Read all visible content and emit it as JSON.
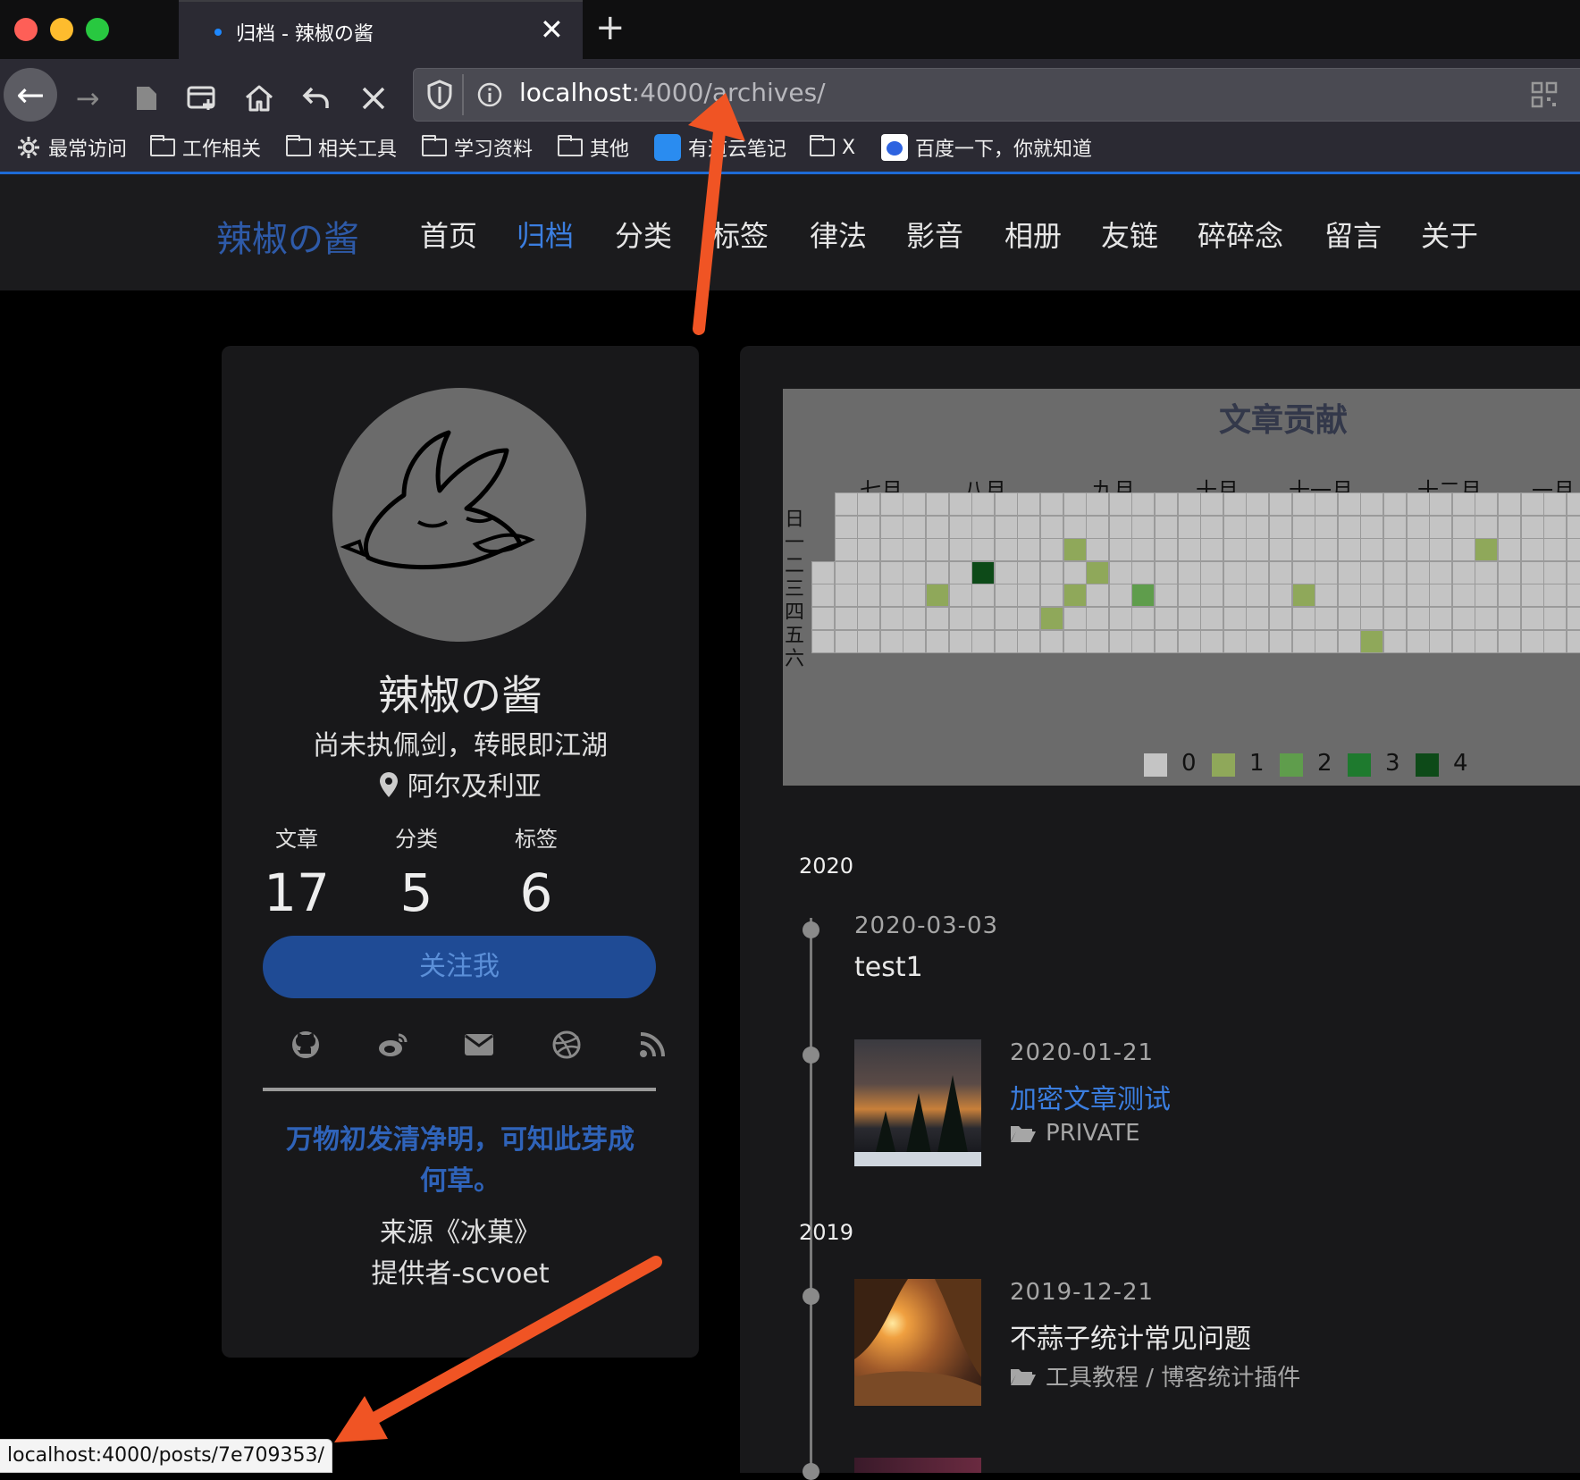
{
  "browser": {
    "tab_title": "归档 - 辣椒の酱",
    "tab_close": "✕",
    "new_tab": "+",
    "url_host": "localhost",
    "url_path": ":4000/archives/",
    "status_url": "localhost:4000/posts/7e709353/",
    "bookmarks": [
      "最常访问",
      "工作相关",
      "相关工具",
      "学习资料",
      "其他",
      "有道云笔记",
      "X",
      "百度一下，你就知道"
    ]
  },
  "site": {
    "logo": "辣椒の酱",
    "menu": [
      "首页",
      "归档",
      "分类",
      "标签",
      "律法",
      "影音",
      "相册",
      "友链",
      "碎碎念",
      "留言",
      "关于"
    ],
    "active_menu": "归档"
  },
  "profile": {
    "name": "辣椒の酱",
    "motto": "尚未执佩剑，转眼即江湖",
    "location": "阿尔及利亚",
    "stats": [
      {
        "label": "文章",
        "value": "17"
      },
      {
        "label": "分类",
        "value": "5"
      },
      {
        "label": "标签",
        "value": "6"
      }
    ],
    "follow_button": "关注我",
    "social_icons": [
      "github-icon",
      "weibo-icon",
      "email-icon",
      "dribbble-icon",
      "rss-icon"
    ],
    "quote": "万物初发清净明，可知此芽成何草。",
    "quote_source": "来源《冰菓》",
    "quote_provider": "提供者-scvoet"
  },
  "heatmap": {
    "title": "文章贡献",
    "months": [
      "七月",
      "八月",
      "九月",
      "十月",
      "十一月",
      "十二月",
      "一月"
    ],
    "weekdays": [
      "日",
      "一",
      "二",
      "三",
      "四",
      "五",
      "六"
    ],
    "legend": [
      "0",
      "1",
      "2",
      "3",
      "4"
    ],
    "colors": [
      "#c4c4c4",
      "#8fa85a",
      "#5f9d4c",
      "#1e7a2e",
      "#0d4a18"
    ],
    "active_cells": [
      {
        "week": 7,
        "day": 3,
        "level": 4
      },
      {
        "week": 5,
        "day": 4,
        "level": 1
      },
      {
        "week": 11,
        "day": 2,
        "level": 1
      },
      {
        "week": 12,
        "day": 3,
        "level": 1
      },
      {
        "week": 11,
        "day": 4,
        "level": 1
      },
      {
        "week": 10,
        "day": 5,
        "level": 1
      },
      {
        "week": 14,
        "day": 4,
        "level": 2
      },
      {
        "week": 21,
        "day": 4,
        "level": 1
      },
      {
        "week": 24,
        "day": 6,
        "level": 1
      },
      {
        "week": 29,
        "day": 2,
        "level": 1
      }
    ]
  },
  "archives": [
    {
      "year": "2020",
      "posts": [
        {
          "date": "2020-03-03",
          "title": "test1",
          "category": "",
          "link": false
        },
        {
          "date": "2020-01-21",
          "title": "加密文章测试",
          "category": "PRIVATE",
          "link": true
        }
      ]
    },
    {
      "year": "2019",
      "posts": [
        {
          "date": "2019-12-21",
          "title": "不蒜子统计常见问题",
          "category": "工具教程 / 博客统计插件",
          "link": false
        }
      ]
    }
  ]
}
